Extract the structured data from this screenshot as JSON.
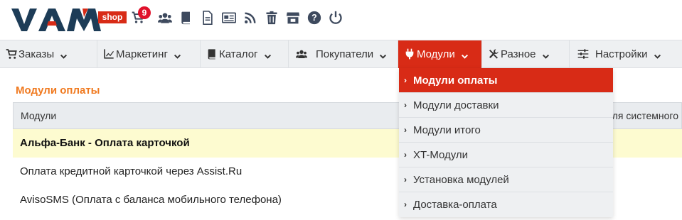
{
  "brand": {
    "logo_text": "VAM",
    "badge": "shop",
    "accent_color": "#d82b16"
  },
  "toolbar": {
    "cart_count": "9",
    "icons": [
      "cart-icon",
      "users-icon",
      "book-icon",
      "file-icon",
      "newspaper-icon",
      "rss-icon",
      "trash-icon",
      "store-icon",
      "help-icon",
      "power-icon"
    ]
  },
  "nav": {
    "items": [
      {
        "label": "Заказы",
        "icon": "cart-icon"
      },
      {
        "label": "Маркетинг",
        "icon": "chart-icon"
      },
      {
        "label": "Каталог",
        "icon": "book-icon"
      },
      {
        "label": "Покупатели",
        "icon": "users-icon"
      },
      {
        "label": "Модули",
        "icon": "plug-icon",
        "active": true
      },
      {
        "label": "Разное",
        "icon": "tools-icon"
      },
      {
        "label": "Настройки",
        "icon": "sliders-icon"
      }
    ]
  },
  "dropdown": {
    "items": [
      {
        "label": "Модули оплаты",
        "active": true
      },
      {
        "label": "Модули доставки"
      },
      {
        "label": "Модули итого"
      },
      {
        "label": "XT-Модули"
      },
      {
        "label": "Установка модулей"
      },
      {
        "label": "Доставка-оплата"
      }
    ]
  },
  "main": {
    "section_title": "Модули оплаты",
    "table": {
      "headers": [
        "Модули",
        "для системного"
      ],
      "rows": [
        "Альфа-Банк - Оплата карточкой",
        "Оплата кредитной карточкой через Assist.Ru",
        "AvisoSMS (Оплата с баланса мобильного телефона)"
      ]
    }
  }
}
